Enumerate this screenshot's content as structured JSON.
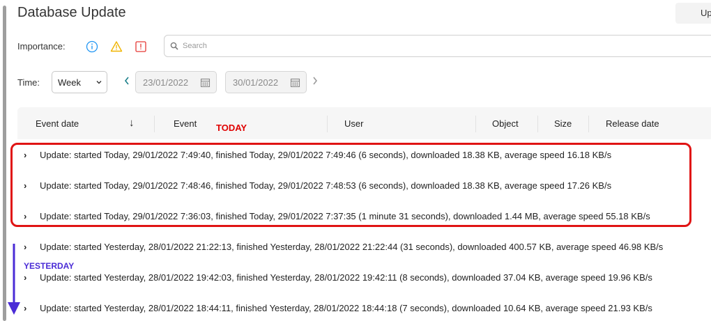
{
  "page": {
    "title": "Database Update",
    "top_button_label": "Up"
  },
  "filters": {
    "importance_label": "Importance:",
    "importance_buttons": [
      {
        "name": "info",
        "color": "#2196f3"
      },
      {
        "name": "warning",
        "color": "#f0b400"
      },
      {
        "name": "error",
        "color": "#e53935"
      }
    ],
    "search_placeholder": "Search",
    "time_label": "Time:",
    "period_value": "Week",
    "date_from": "23/01/2022",
    "date_to": "30/01/2022"
  },
  "table": {
    "columns": [
      "Event date",
      "Event",
      "User",
      "Object",
      "Size",
      "Release date"
    ],
    "sort_indicator": "↓",
    "rows": [
      "Update: started Today, 29/01/2022 7:49:40, finished Today, 29/01/2022 7:49:46 (6 seconds), downloaded 18.38 KB, average speed 16.18 KB/s",
      "Update: started Today, 29/01/2022 7:48:46, finished Today, 29/01/2022 7:48:53 (6 seconds), downloaded 18.38 KB, average speed 17.26 KB/s",
      "Update: started Today, 29/01/2022 7:36:03, finished Today, 29/01/2022 7:37:35 (1 minute 31 seconds), downloaded 1.44 MB, average speed 55.18 KB/s",
      "Update: started Yesterday, 28/01/2022 21:22:13, finished Yesterday, 28/01/2022 21:22:44 (31 seconds), downloaded 400.57 KB, average speed 46.98 KB/s",
      "Update: started Yesterday, 28/01/2022 19:42:03, finished Yesterday, 28/01/2022 19:42:11 (8 seconds), downloaded 37.04 KB, average speed 19.96 KB/s",
      "Update: started Yesterday, 28/01/2022 18:44:11, finished Yesterday, 28/01/2022 18:44:18 (7 seconds), downloaded 10.64 KB, average speed 21.93 KB/s"
    ]
  },
  "annotations": {
    "today_label": "TODAY",
    "today_color": "#e00000",
    "yesterday_label": "YESTERDAY",
    "yesterday_color": "#4a2bd6"
  }
}
